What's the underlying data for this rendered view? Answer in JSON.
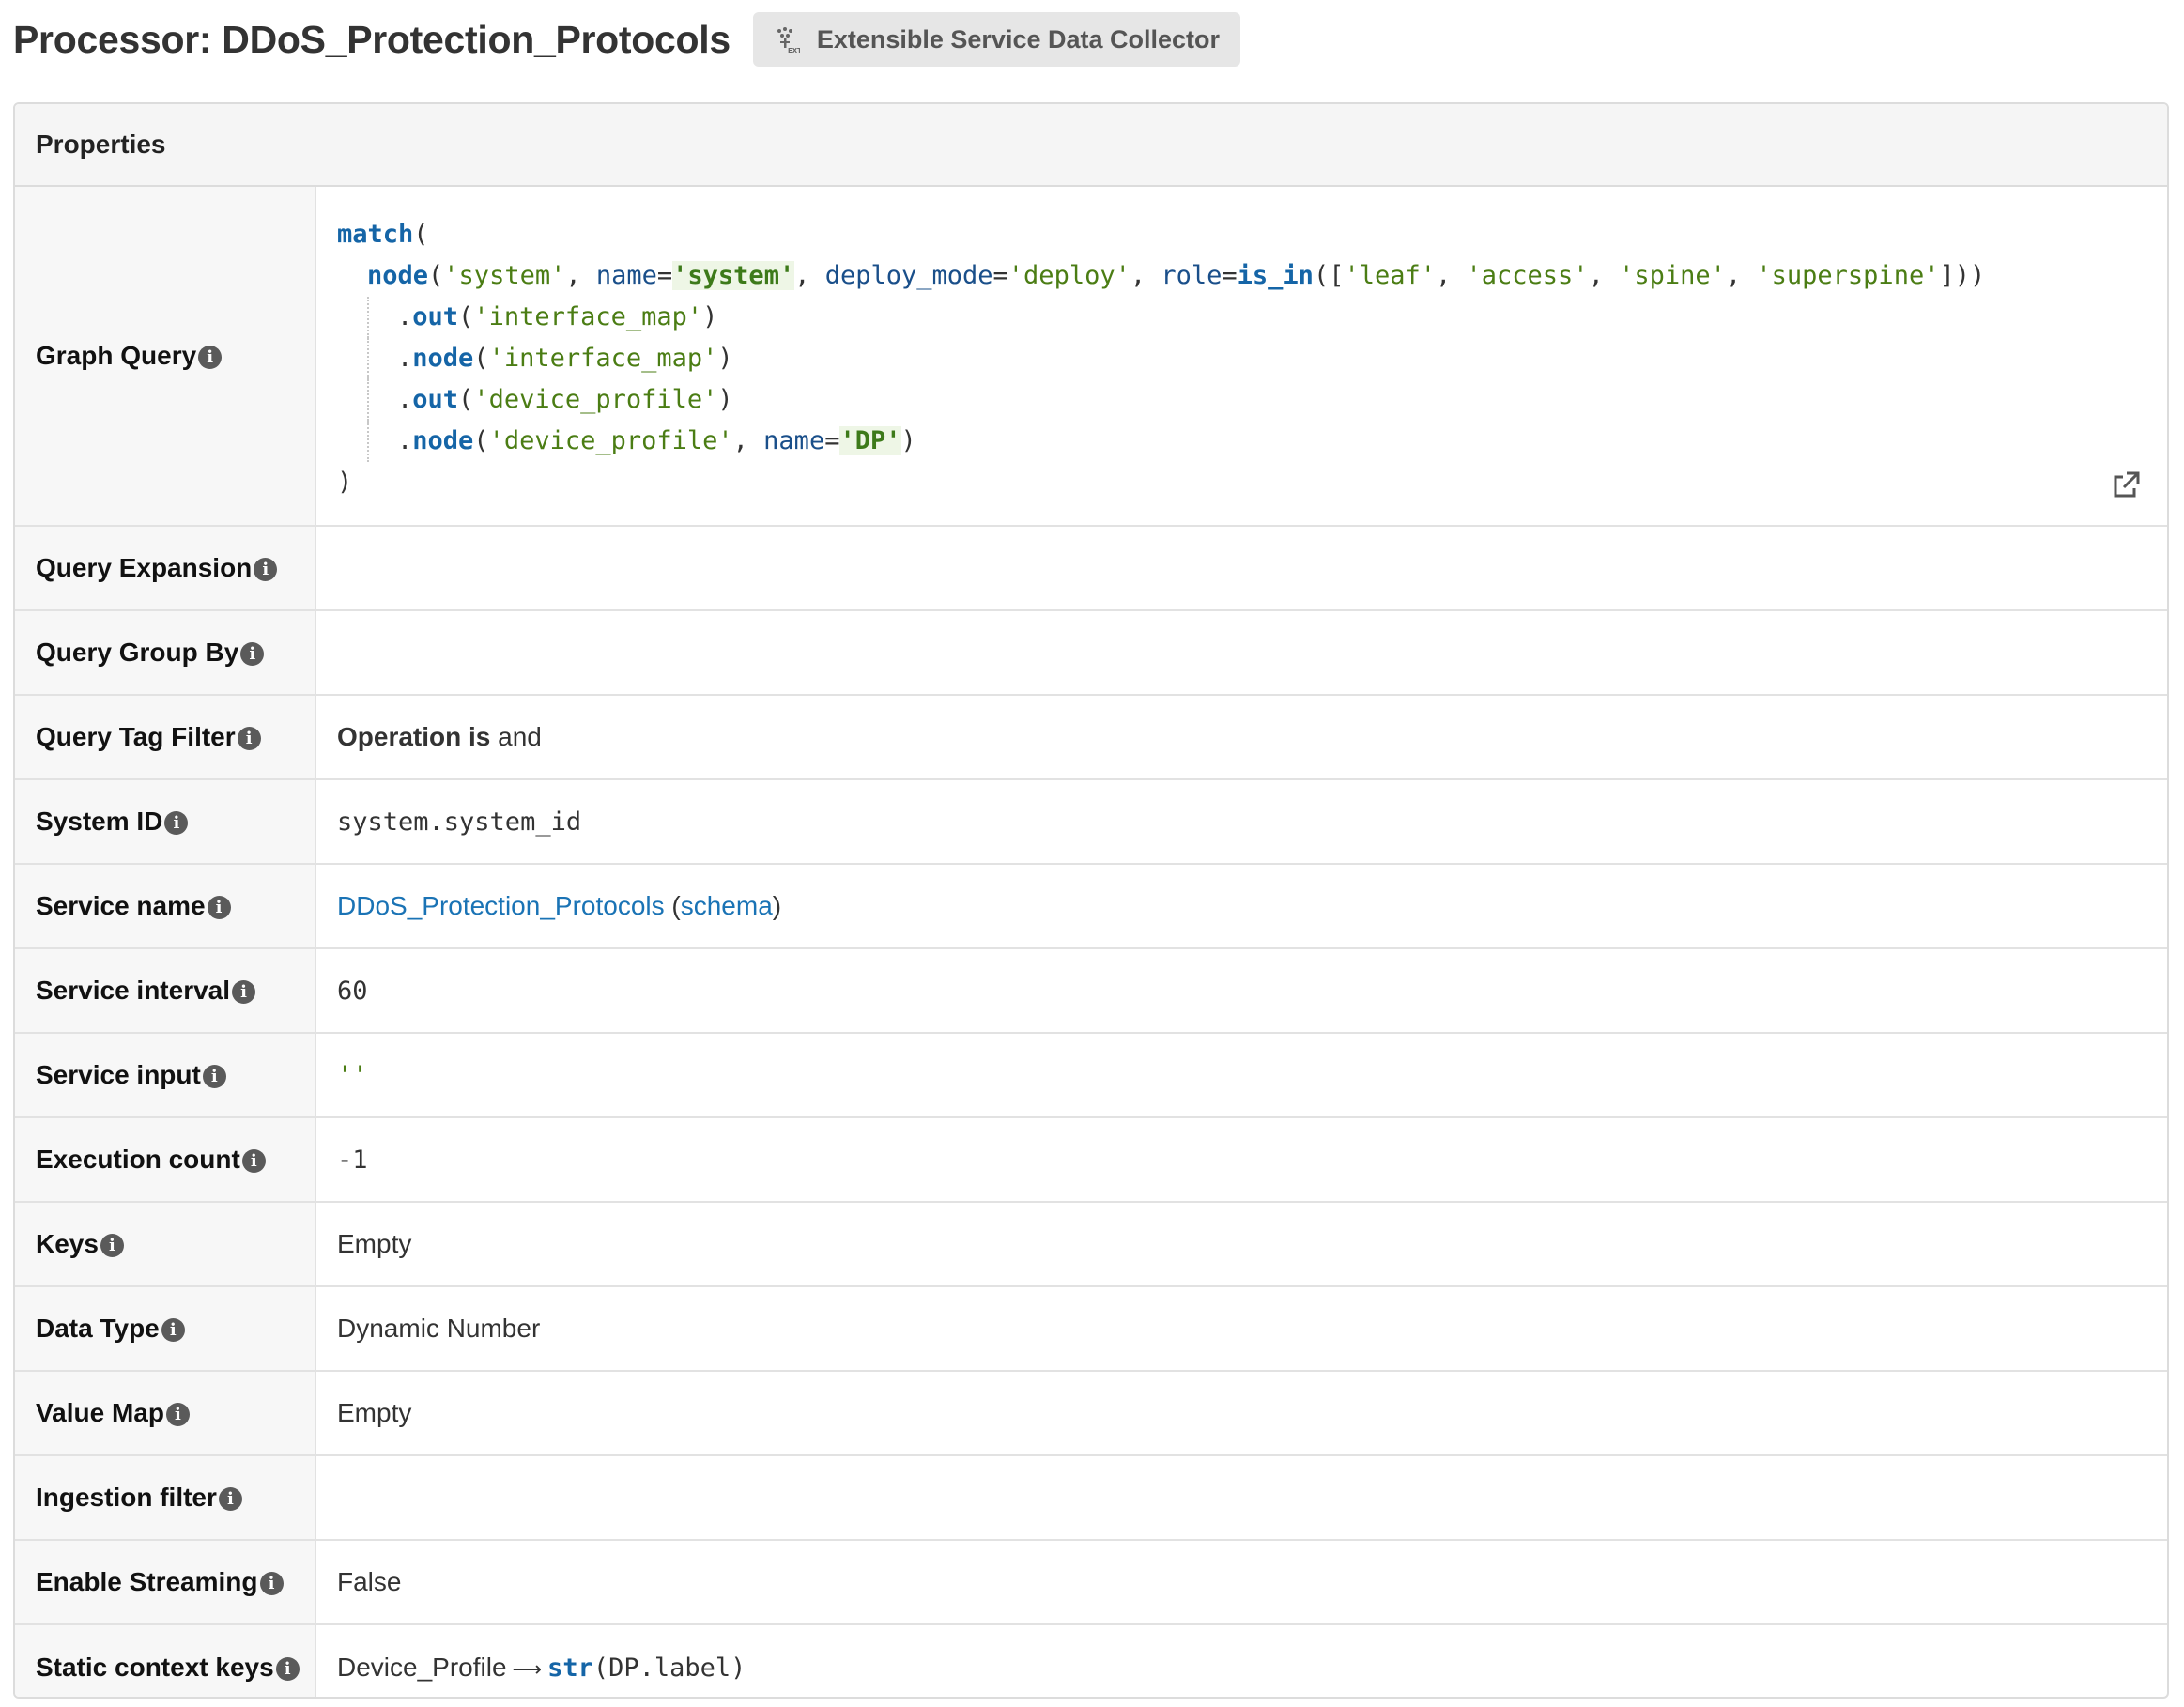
{
  "header": {
    "title": "Processor: DDoS_Protection_Protocols",
    "badge_label": "Extensible Service Data Collector",
    "badge_icon": "extensible-collector-icon"
  },
  "panel": {
    "title": "Properties"
  },
  "graph_query": {
    "label": "Graph Query",
    "lines": {
      "l1": {
        "kw": "match",
        "rest": "("
      },
      "l2": {
        "kw": "node",
        "p1": "(",
        "s1": "'system'",
        "p2": ", ",
        "a1": "name",
        "eq1": "=",
        "h1": "'system'",
        "p3": ", ",
        "a2": "deploy_mode",
        "eq2": "=",
        "s2": "'deploy'",
        "p4": ", ",
        "a3": "role",
        "eq3": "=",
        "kw2": "is_in",
        "p5": "([",
        "s3": "'leaf'",
        "p6": ", ",
        "s4": "'access'",
        "p7": ", ",
        "s5": "'spine'",
        "p8": ", ",
        "s6": "'superspine'",
        "p9": "]))"
      },
      "l3": {
        "dot": ".",
        "kw": "out",
        "p1": "(",
        "s": "'interface_map'",
        "p2": ")"
      },
      "l4": {
        "dot": ".",
        "kw": "node",
        "p1": "(",
        "s": "'interface_map'",
        "p2": ")"
      },
      "l5": {
        "dot": ".",
        "kw": "out",
        "p1": "(",
        "s": "'device_profile'",
        "p2": ")"
      },
      "l6": {
        "dot": ".",
        "kw": "node",
        "p1": "(",
        "s": "'device_profile'",
        "p2": ", ",
        "a": "name",
        "eq": "=",
        "h": "'DP'",
        "p3": ")"
      },
      "l7": ")"
    },
    "open_icon": "external-link-icon"
  },
  "rows": {
    "query_expansion": {
      "label": "Query Expansion",
      "value": ""
    },
    "query_group_by": {
      "label": "Query Group By",
      "value": ""
    },
    "query_tag_filter": {
      "label": "Query Tag Filter",
      "value_bold": "Operation is",
      "value": "and"
    },
    "system_id": {
      "label": "System ID",
      "value": "system.system_id"
    },
    "service_name": {
      "label": "Service name",
      "link": "DDoS_Protection_Protocols",
      "schema_open": "(",
      "schema_link": "schema",
      "schema_close": ")"
    },
    "service_interval": {
      "label": "Service interval",
      "value": "60"
    },
    "service_input": {
      "label": "Service input",
      "value": "''"
    },
    "execution_count": {
      "label": "Execution count",
      "value": "-1"
    },
    "keys": {
      "label": "Keys",
      "value": "Empty"
    },
    "data_type": {
      "label": "Data Type",
      "value": "Dynamic Number"
    },
    "value_map": {
      "label": "Value Map",
      "value": "Empty"
    },
    "ingestion_filter": {
      "label": "Ingestion filter",
      "value": ""
    },
    "enable_streaming": {
      "label": "Enable Streaming",
      "value": "False"
    },
    "static_context_keys": {
      "label": "Static context keys",
      "key": "Device_Profile",
      "arrow": "⟶",
      "fn": "str",
      "expr": "(DP.label)"
    }
  },
  "info_icon_glyph": "i"
}
